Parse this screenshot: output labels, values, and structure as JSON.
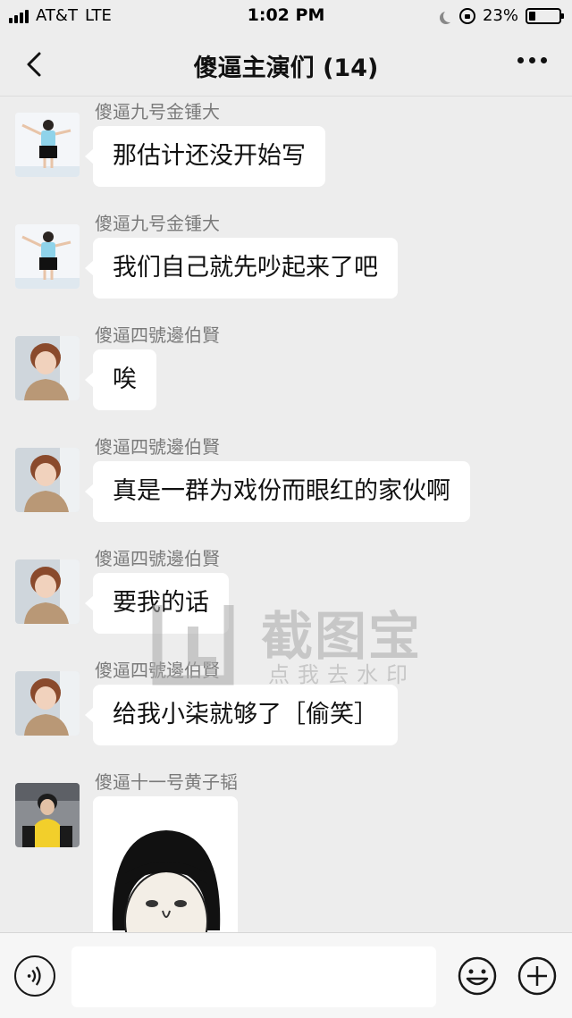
{
  "status_bar": {
    "carrier": "AT&T",
    "network": "LTE",
    "time": "1:02 PM",
    "battery_percent": "23%",
    "battery_level": 0.23
  },
  "nav": {
    "title": "傻逼主演们 (14)",
    "back_icon": "chevron-left-icon",
    "more_icon": "more-dots-icon"
  },
  "messages": [
    {
      "sender": "傻逼九号金锺大",
      "text": "那估计还没开始写",
      "avatar": "avatar-jongdae"
    },
    {
      "sender": "傻逼九号金锺大",
      "text": "我们自己就先吵起来了吧",
      "avatar": "avatar-jongdae"
    },
    {
      "sender": "傻逼四號邊伯賢",
      "text": "唉",
      "avatar": "avatar-baekhyun"
    },
    {
      "sender": "傻逼四號邊伯賢",
      "text": "真是一群为戏份而眼红的家伙啊",
      "avatar": "avatar-baekhyun"
    },
    {
      "sender": "傻逼四號邊伯賢",
      "text": "要我的话",
      "avatar": "avatar-baekhyun"
    },
    {
      "sender": "傻逼四號邊伯賢",
      "text": "给我小柒就够了［偷笑］",
      "avatar": "avatar-baekhyun"
    },
    {
      "sender": "傻逼十一号黄子韬",
      "sticker": "meme-face-sticker",
      "avatar": "avatar-zitao"
    }
  ],
  "watermark": {
    "title": "截图宝",
    "subtitle": "点我去水印"
  },
  "input_bar": {
    "placeholder": "",
    "voice_icon": "voice-icon",
    "emoji_icon": "emoji-icon",
    "plus_icon": "plus-icon"
  },
  "colors": {
    "background": "#ededed",
    "bubble": "#ffffff",
    "sender_text": "#7a7a7a"
  }
}
